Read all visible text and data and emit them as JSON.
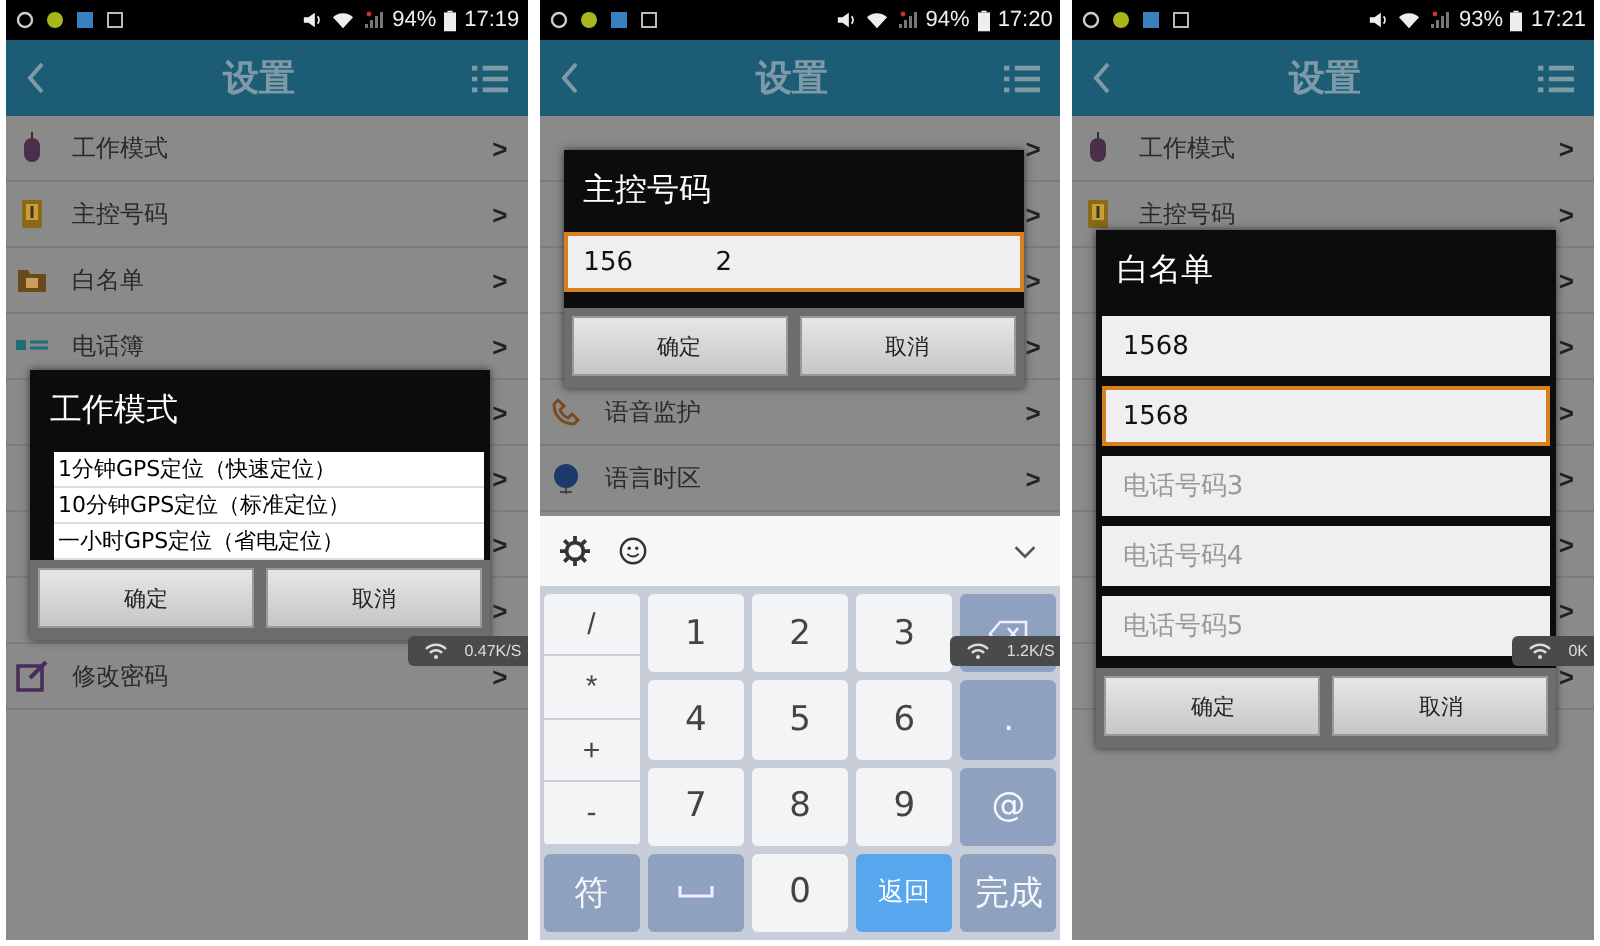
{
  "panels": [
    {
      "status_bar": {
        "battery": "94%",
        "time": "17:19"
      },
      "header": {
        "title": "设置"
      },
      "rows": [
        {
          "label": "工作模式",
          "arrow": ">"
        },
        {
          "label": "主控号码",
          "arrow": ">"
        },
        {
          "label": "白名单",
          "arrow": ">"
        },
        {
          "label": "电话簿",
          "arrow": ">"
        },
        {
          "arrow": ">"
        },
        {
          "arrow": ">"
        },
        {
          "arrow": ">"
        },
        {
          "arrow": ">"
        },
        {
          "label": "修改密码",
          "arrow": ">"
        }
      ],
      "dialog": {
        "kind": "options",
        "title": "工作模式",
        "options": [
          "1分钟GPS定位（快速定位）",
          "10分钟GPS定位（标准定位）",
          "一小时GPS定位（省电定位）"
        ],
        "buttons": [
          "确定",
          "取消"
        ]
      },
      "net_speed": "0.47K/S"
    },
    {
      "status_bar": {
        "battery": "94%",
        "time": "17:20"
      },
      "header": {
        "title": "设置"
      },
      "rows": [
        {
          "arrow": ">"
        },
        {
          "arrow": ">"
        },
        {
          "arrow": ">"
        },
        {
          "arrow": ">"
        },
        {
          "label": "语音监护",
          "arrow": ">"
        },
        {
          "label": "语言时区",
          "arrow": ">"
        }
      ],
      "dialog": {
        "kind": "input",
        "title": "主控号码",
        "fields": [
          {
            "value": "156          2",
            "focused": true
          }
        ],
        "buttons": [
          "确定",
          "取消"
        ]
      },
      "keyboard": {
        "symbols": [
          "/",
          "*",
          "+",
          "-"
        ],
        "keys": [
          {
            "kind": "num",
            "label": "1"
          },
          {
            "kind": "num",
            "label": "2"
          },
          {
            "kind": "num",
            "label": "3"
          },
          {
            "kind": "backspace"
          },
          {
            "kind": "num",
            "label": "4"
          },
          {
            "kind": "num",
            "label": "5"
          },
          {
            "kind": "num",
            "label": "6"
          },
          {
            "kind": "func",
            "label": "."
          },
          {
            "kind": "num",
            "label": "7"
          },
          {
            "kind": "num",
            "label": "8"
          },
          {
            "kind": "num",
            "label": "9"
          },
          {
            "kind": "func",
            "label": "@"
          },
          {
            "kind": "func",
            "label": "符"
          },
          {
            "kind": "space"
          },
          {
            "kind": "num",
            "label": "0"
          },
          {
            "kind": "accent",
            "label": "返回"
          },
          {
            "kind": "func",
            "label": "完成"
          }
        ]
      },
      "net_speed": "1.2K/S"
    },
    {
      "status_bar": {
        "battery": "93%",
        "time": "17:21"
      },
      "header": {
        "title": "设置"
      },
      "rows": [
        {
          "label": "工作模式",
          "arrow": ">"
        },
        {
          "label": "主控号码",
          "arrow": ">"
        },
        {
          "arrow": ">"
        },
        {
          "arrow": ">"
        },
        {
          "arrow": ">"
        },
        {
          "arrow": ">"
        },
        {
          "arrow": ">"
        },
        {
          "arrow": ">"
        },
        {
          "arrow": ">"
        }
      ],
      "dialog": {
        "kind": "fields",
        "title": "白名单",
        "fields": [
          {
            "value": "1568",
            "focused": false
          },
          {
            "value": "1568",
            "focused": true
          },
          {
            "placeholder": "电话号码3",
            "focused": false
          },
          {
            "placeholder": "电话号码4",
            "focused": false
          },
          {
            "placeholder": "电话号码5",
            "focused": false
          }
        ],
        "buttons": [
          "确定",
          "取消"
        ]
      },
      "net_speed": "0K"
    }
  ]
}
